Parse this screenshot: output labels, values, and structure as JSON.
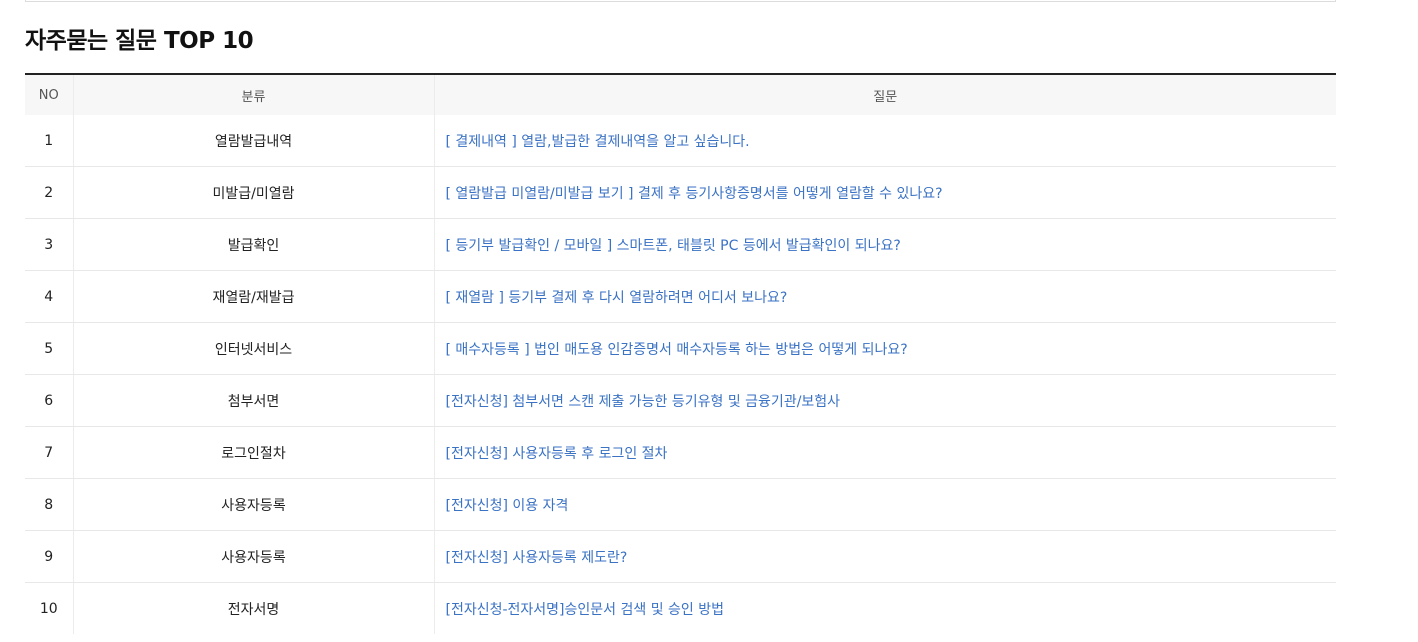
{
  "page": {
    "title": "자주묻는 질문 TOP 10"
  },
  "table": {
    "headers": {
      "no": "NO",
      "category": "분류",
      "question": "질문"
    },
    "rows": [
      {
        "no": "1",
        "category": "열람발급내역",
        "question": "[ 결제내역 ] 열람,발급한 결제내역을 알고 싶습니다."
      },
      {
        "no": "2",
        "category": "미발급/미열람",
        "question": "[ 열람발급 미열람/미발급 보기 ] 결제 후 등기사항증명서를 어떻게 열람할 수 있나요?"
      },
      {
        "no": "3",
        "category": "발급확인",
        "question": "[ 등기부 발급확인 / 모바일 ] 스마트폰, 태블릿 PC 등에서 발급확인이 되나요?"
      },
      {
        "no": "4",
        "category": "재열람/재발급",
        "question": "[ 재열람 ] 등기부 결제 후 다시 열람하려면 어디서 보나요?"
      },
      {
        "no": "5",
        "category": "인터넷서비스",
        "question": "[ 매수자등록 ] 법인 매도용 인감증명서 매수자등록 하는 방법은 어떻게 되나요?"
      },
      {
        "no": "6",
        "category": "첨부서면",
        "question": "[전자신청] 첨부서면 스캔 제출 가능한 등기유형 및 금융기관/보험사"
      },
      {
        "no": "7",
        "category": "로그인절차",
        "question": "[전자신청] 사용자등록 후 로그인 절차"
      },
      {
        "no": "8",
        "category": "사용자등록",
        "question": "[전자신청] 이용 자격"
      },
      {
        "no": "9",
        "category": "사용자등록",
        "question": "[전자신청] 사용자등록 제도란?"
      },
      {
        "no": "10",
        "category": "전자서명",
        "question": "[전자신청-전자서명]승인문서 검색 및 승인 방법"
      }
    ]
  },
  "colors": {
    "link": "#3a72c4",
    "header_bg": "#f7f7f7",
    "top_border": "#222222"
  }
}
